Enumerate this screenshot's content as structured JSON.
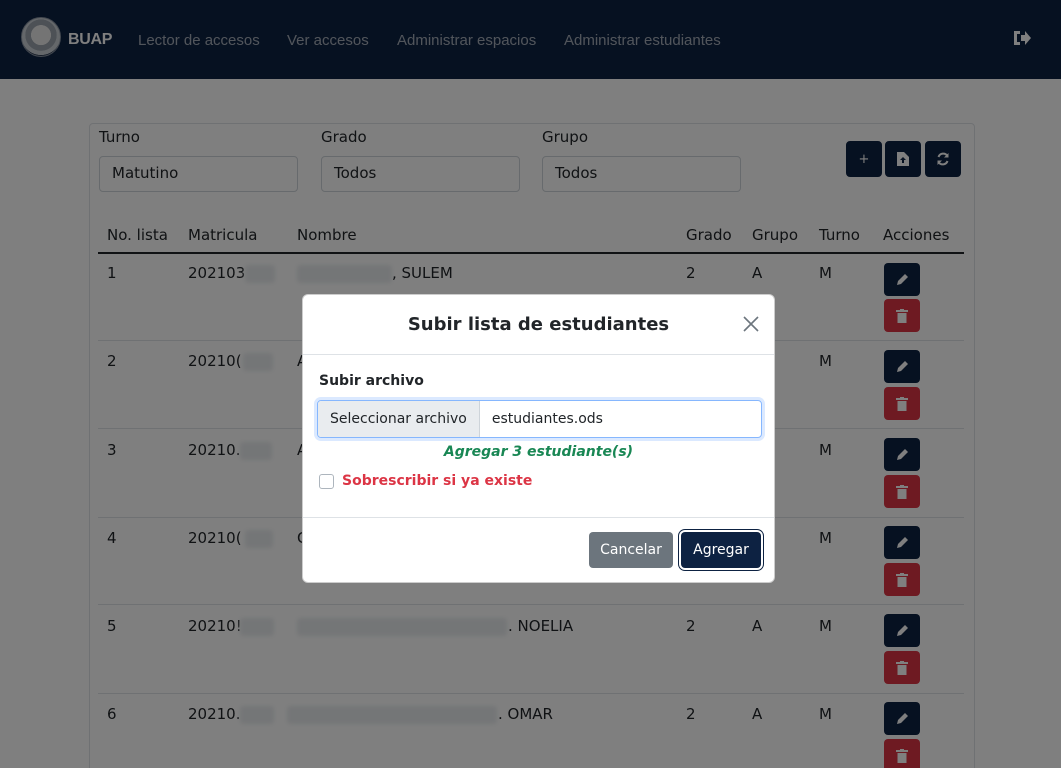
{
  "navbar": {
    "brand": "BUAP",
    "links": [
      "Lector de accesos",
      "Ver accesos",
      "Administrar espacios",
      "Administrar estudiantes"
    ],
    "logo_icon": "university-seal-icon",
    "logout_icon": "logout-icon"
  },
  "filters": {
    "turno": {
      "label": "Turno",
      "value": "Matutino"
    },
    "grado": {
      "label": "Grado",
      "value": "Todos"
    },
    "grupo": {
      "label": "Grupo",
      "value": "Todos"
    }
  },
  "toolbar": {
    "add_label": "+",
    "add_icon": "plus-icon",
    "upload_icon": "file-upload-icon",
    "refresh_icon": "refresh-icon"
  },
  "table": {
    "headers": [
      "No. lista",
      "Matricula",
      "Nombre",
      "Grado",
      "Grupo",
      "Turno",
      "Acciones"
    ],
    "rows": [
      {
        "no": "1",
        "matricula": "202103",
        "nombre": ", SULEM",
        "grado": "2",
        "grupo": "A",
        "turno": "M"
      },
      {
        "no": "2",
        "matricula": "20210(",
        "nombre": "A",
        "grado": "",
        "grupo": "",
        "turno": "M"
      },
      {
        "no": "3",
        "matricula": "20210.",
        "nombre": "A",
        "grado": "",
        "grupo": "",
        "turno": "M"
      },
      {
        "no": "4",
        "matricula": "20210(",
        "nombre": "C",
        "grado": "",
        "grupo": "",
        "turno": "M"
      },
      {
        "no": "5",
        "matricula": "20210!",
        "nombre": ". NOELIA",
        "grado": "2",
        "grupo": "A",
        "turno": "M"
      },
      {
        "no": "6",
        "matricula": "20210.",
        "nombre": ". OMAR",
        "grado": "2",
        "grupo": "A",
        "turno": "M"
      }
    ]
  },
  "modal": {
    "title": "Subir lista de estudiantes",
    "field_label": "Subir archivo",
    "file_button": "Seleccionar archivo",
    "file_name": "estudiantes.ods",
    "hint": "Agregar 3 estudiante(s)",
    "checkbox_label": "Sobrescribir si ya existe",
    "cancel": "Cancelar",
    "submit": "Agregar"
  },
  "colors": {
    "primary": "#0d2242",
    "danger": "#dc3545",
    "success": "#198754",
    "secondary": "#6c757d"
  }
}
